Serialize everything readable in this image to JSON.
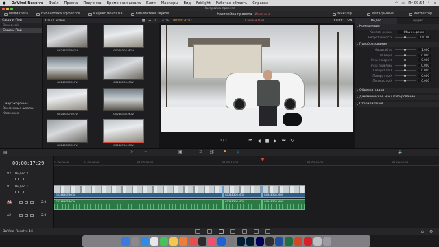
{
  "menubar": {
    "app": "DaVinci Resolve",
    "items": [
      "Файл",
      "Правка",
      "Подгонка",
      "Временная шкала",
      "Клип",
      "Маркеры",
      "Вид",
      "Fairlight",
      "Рабочая область",
      "Справка"
    ],
    "clock": "Пт 09:54"
  },
  "window_title": "Настройка проекта",
  "toolbar": {
    "items": [
      "Медиатека",
      "Библиотека эффектов",
      "Индекс монтажа",
      "Библиотека звуков"
    ],
    "project_title": "Настройка проекта",
    "edited": "Изменено",
    "right_items": [
      "Микшер",
      "Метаданные",
      "Инспектор"
    ]
  },
  "left_panel": {
    "header": "Саша и Пой",
    "section": "Основной",
    "selected_bin": "Саша и Пай",
    "smart_bins_title": "Смарт-корзины",
    "smart_bins": [
      "Временные шкалы",
      "Ключевое"
    ]
  },
  "media_pool": {
    "header": "Саша и Пой",
    "clips": [
      "G0248303.MOV",
      "G0248304.MOV",
      "G0248305.MOV",
      "G0248306.MOV",
      "G0248307.MOV",
      "G0248308.MOV",
      "G0248309.MOV",
      "G0248310.MOV"
    ],
    "selected_index": 7
  },
  "viewer": {
    "zoom": "47%",
    "source_timecode": "00:00:20:01",
    "clip_name": "Саша и Пай",
    "record_timecode": "00:00:17:29",
    "page_counter": "1 / 3"
  },
  "inspector": {
    "tabs": [
      "Видео",
      "Аудио"
    ],
    "active_tab": "Видео",
    "sections": {
      "composite": "Композиция",
      "transform": "Преобразование",
      "crop": "Обрезка кадра",
      "dynamic_zoom": "Динамическое масштабирование",
      "stabilization": "Стабилизация"
    },
    "composite_rows": [
      {
        "label": "Композ. режим",
        "value": "Обычн...режи"
      },
      {
        "label": "Непрозрачность",
        "value": "100.00"
      }
    ],
    "transform_rows": [
      {
        "label": "Масштаб по",
        "value": "1.000"
      },
      {
        "label": "Позиция",
        "value": "0.000"
      },
      {
        "label": "Угол поворота",
        "value": "0.000"
      },
      {
        "label": "Точка привязки",
        "value": "0.000"
      },
      {
        "label": "Поворот по Y",
        "value": "0.000"
      },
      {
        "label": "Поворот по X",
        "value": "0.000"
      },
      {
        "label": "Перекос по X",
        "value": "0.000"
      }
    ]
  },
  "timeline": {
    "timecode": "00:00:17:29",
    "ruler_ticks": [
      "01:00:00:00",
      "01:00:05:00",
      "01:00:10:00",
      "01:00:15:00",
      "01:00:20:00",
      "01:00:25:00"
    ],
    "tracks": [
      {
        "id": "V2",
        "name": "Видео 2"
      },
      {
        "id": "V1",
        "name": "Видео 1"
      },
      {
        "id": "A1",
        "name": "2.0"
      },
      {
        "id": "A2",
        "name": "2.0"
      }
    ],
    "video_clips": [
      "G0248305.MOV",
      "G0248306.MOV",
      "G0248308.MOV"
    ],
    "audio_clips": [
      "G0248305.MOV",
      "G0248306.MOV",
      "G0248308.MOV"
    ]
  },
  "pagebar": {
    "app_label": "DaVinci Resolve 16"
  },
  "colors": {
    "accent_orange": "#e09b42",
    "playhead_red": "#e3433a",
    "video_clip_blue": "#2e5f89",
    "audio_clip_green": "#2b7a45"
  }
}
